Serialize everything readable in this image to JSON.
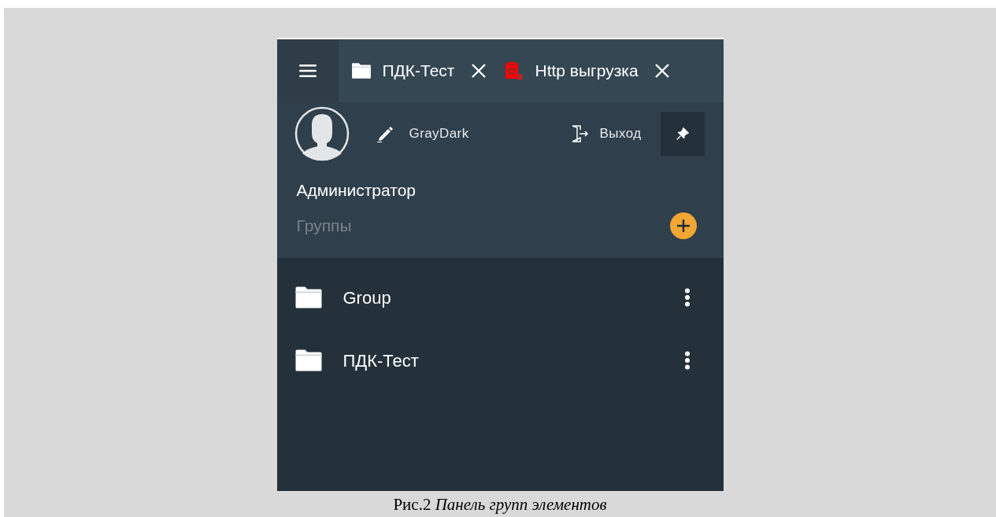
{
  "tabs": [
    {
      "label": "ПДК-Тест",
      "kind": "folder"
    },
    {
      "label": "Http выгрузка",
      "kind": "clipboard"
    }
  ],
  "user_panel": {
    "theme_label": "GrayDark",
    "logout_label": "Выход",
    "pinned": true,
    "user_name": "Администратор",
    "groups_heading": "Группы"
  },
  "groups": [
    {
      "name": "Group"
    },
    {
      "name": "ПДК-Тест"
    }
  ],
  "caption": "Рис.2 *Панель групп элементов*"
}
